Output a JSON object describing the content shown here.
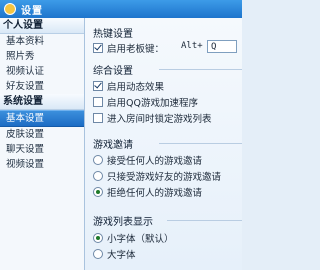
{
  "window": {
    "title": "设置"
  },
  "sidebar": {
    "groups": [
      {
        "label": "个人设置",
        "items": [
          "基本资料",
          "照片秀",
          "视频认证",
          "好友设置"
        ]
      },
      {
        "label": "系统设置",
        "items": [
          "基本设置",
          "皮肤设置",
          "聊天设置",
          "视频设置"
        ]
      }
    ],
    "selected": "基本设置"
  },
  "hotkey_section": {
    "title": "热键设置",
    "boss_key_label": "启用老板键：",
    "boss_key_checked": true,
    "hotkey_prefix": "Alt+",
    "hotkey_value": "Q"
  },
  "general_section": {
    "title": "综合设置",
    "options": [
      {
        "label": "启用动态效果",
        "checked": true
      },
      {
        "label": "启用QQ游戏加速程序",
        "checked": false
      },
      {
        "label": "进入房间时锁定游戏列表",
        "checked": false
      }
    ]
  },
  "invite_section": {
    "title": "游戏邀请",
    "options": [
      {
        "label": "接受任何人的游戏邀请",
        "checked": false
      },
      {
        "label": "只接受游戏好友的游戏邀请",
        "checked": false
      },
      {
        "label": "拒绝任何人的游戏邀请",
        "checked": true
      }
    ]
  },
  "list_section": {
    "title": "游戏列表显示",
    "options": [
      {
        "label": "小字体（默认）",
        "checked": true
      },
      {
        "label": "大字体",
        "checked": false
      }
    ]
  }
}
